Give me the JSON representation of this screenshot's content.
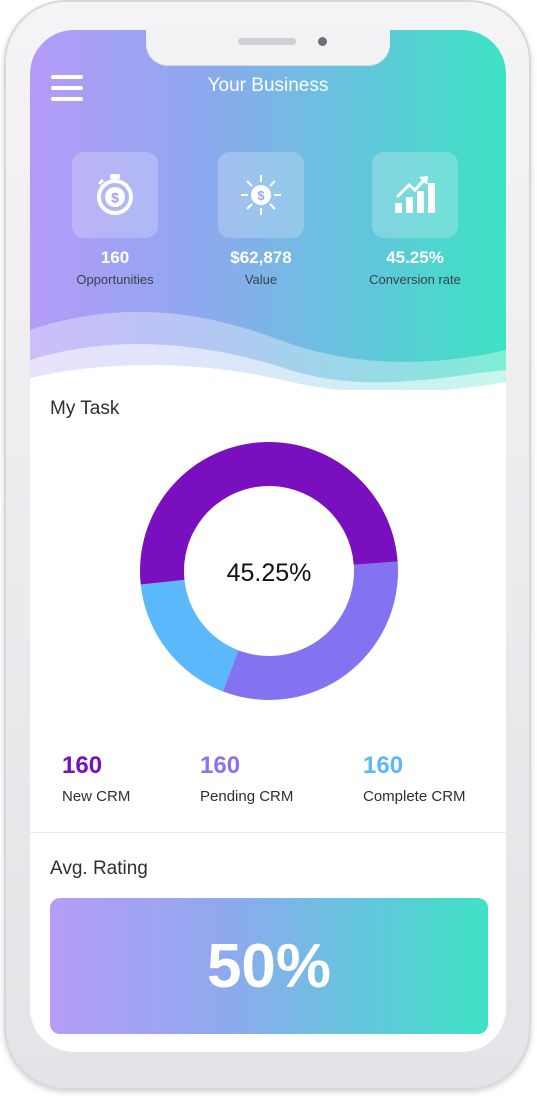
{
  "header": {
    "title": "Your Business"
  },
  "stats": [
    {
      "value": "160",
      "label": "Opportunities",
      "icon": "stopwatch-dollar-icon"
    },
    {
      "value": "$62,878",
      "label": "Value",
      "icon": "dollar-spread-icon"
    },
    {
      "value": "45.25%",
      "label": "Conversion rate",
      "icon": "growth-chart-icon"
    }
  ],
  "task": {
    "title": "My Task",
    "center_label": "45.25%",
    "legend": [
      {
        "value": "160",
        "label": "New CRM",
        "color": "#7a0fbf"
      },
      {
        "value": "160",
        "label": "Pending CRM",
        "color": "#8b72f0"
      },
      {
        "value": "160",
        "label": "Complete CRM",
        "color": "#5bb8fb"
      }
    ]
  },
  "chart_data": {
    "type": "pie",
    "title": "",
    "center_label": "45.25%",
    "segments": [
      {
        "label": "New CRM",
        "value": 50.5,
        "color": "#7a0fbf"
      },
      {
        "label": "Pending CRM",
        "value": 32.0,
        "color": "#8373f1"
      },
      {
        "label": "Complete CRM",
        "value": 17.5,
        "color": "#5bb8fb"
      }
    ]
  },
  "rating": {
    "title": "Avg. Rating",
    "value": "50%"
  }
}
